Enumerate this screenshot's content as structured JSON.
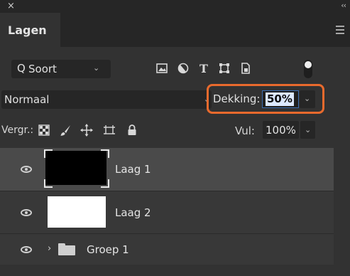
{
  "window": {
    "close_glyph": "×",
    "collapse_glyph": "‹‹"
  },
  "tabs": [
    {
      "label": "Lagen",
      "active": true
    }
  ],
  "panel_menu_icon": "hamburger-menu-icon",
  "filter": {
    "search_glyph": "Q",
    "label": "Soort",
    "icons": [
      "image-filter-icon",
      "adjustment-filter-icon",
      "type-filter-icon",
      "shape-filter-icon",
      "smart-object-filter-icon"
    ],
    "toggle_state": "on"
  },
  "blend": {
    "mode": "Normaal",
    "opacity_label": "Dekking:",
    "opacity_value": "50%",
    "highlight_color": "#e96a2d"
  },
  "locks": {
    "label": "Vergr.:",
    "icons": [
      "lock-transparent-pixels-icon",
      "lock-image-pixels-icon",
      "lock-position-icon",
      "lock-artboard-icon",
      "lock-all-icon"
    ],
    "fill_label": "Vul:",
    "fill_value": "100%"
  },
  "layers": [
    {
      "name": "Laag 1",
      "visible": true,
      "thumbnail_color": "#000000",
      "selected": true
    },
    {
      "name": "Laag 2",
      "visible": true,
      "thumbnail_color": "#ffffff",
      "selected": false
    },
    {
      "name": "Groep 1",
      "visible": true,
      "type": "group",
      "expanded": false,
      "chevron": "›"
    }
  ]
}
